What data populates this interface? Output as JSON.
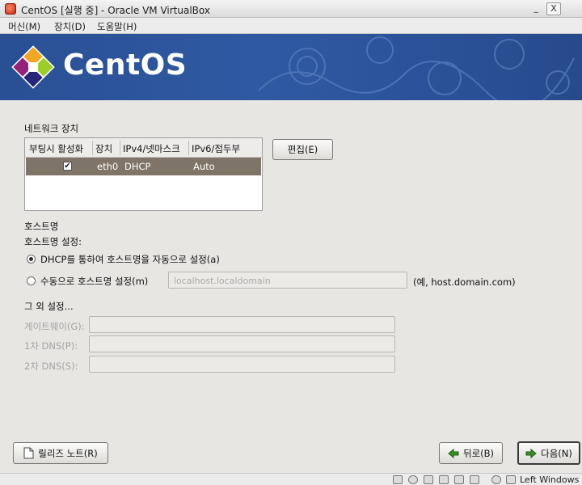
{
  "window": {
    "title": "CentOS [실행 중] - Oracle VM VirtualBox",
    "controls": {
      "minimize": "_",
      "close": "X"
    }
  },
  "menu": [
    "머신(M)",
    "장치(D)",
    "도움말(H)"
  ],
  "banner": {
    "brand": "CentOS"
  },
  "network": {
    "heading": "네트워크 장치",
    "columns": [
      "부팅시 활성화",
      "장치",
      "IPv4/넷마스크",
      "IPv6/접두부"
    ],
    "rows": [
      {
        "active": true,
        "device": "eth0",
        "ipv4": "DHCP",
        "ipv6": "Auto"
      }
    ],
    "edit_button": "편집(E)"
  },
  "hostname": {
    "heading": "호스트명",
    "subheading": "호스트명 설정:",
    "option_dhcp": "DHCP를 통하여 호스트명을 자동으로 설정(a)",
    "option_manual": "수동으로 호스트명 설정(m)",
    "manual_value": "localhost.localdomain",
    "example": "(예, host.domain.com)",
    "selected": "dhcp"
  },
  "other": {
    "heading": "그 외 설정...",
    "gateway_label": "게이트웨이(G):",
    "dns1_label": "1차 DNS(P):",
    "dns2_label": "2차 DNS(S):",
    "gateway_value": "",
    "dns1_value": "",
    "dns2_value": ""
  },
  "footer": {
    "release_notes": "릴리즈 노트(R)",
    "back": "뒤로(B)",
    "next": "다음(N)"
  },
  "statusbar": {
    "host_key": "Left Windows"
  },
  "colors": {
    "banner": "#2f5aa3",
    "selected_row": "#7f7468",
    "background": "#e8e6e3"
  }
}
